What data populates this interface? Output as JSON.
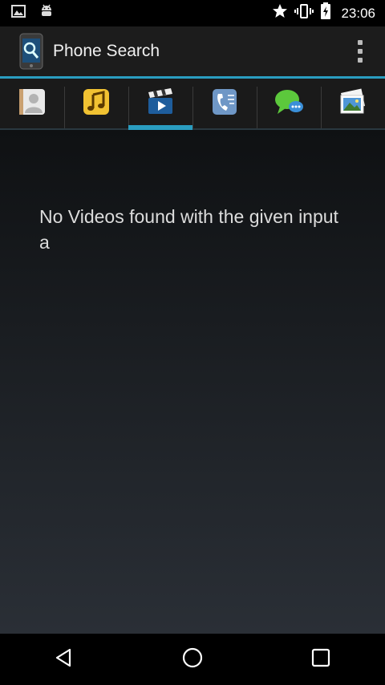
{
  "status_bar": {
    "time": "23:06",
    "icons": [
      "image-notification-icon",
      "android-notification-icon",
      "star-icon",
      "vibrate-icon",
      "battery-icon"
    ]
  },
  "app": {
    "title": "Phone Search",
    "accent_color": "#2a9dc0"
  },
  "tabs": [
    {
      "name": "contacts",
      "icon": "contacts-icon",
      "active": false
    },
    {
      "name": "music",
      "icon": "music-note-icon",
      "active": false
    },
    {
      "name": "videos",
      "icon": "video-clapperboard-icon",
      "active": true
    },
    {
      "name": "call-log",
      "icon": "call-log-icon",
      "active": false
    },
    {
      "name": "messages",
      "icon": "message-bubble-icon",
      "active": false
    },
    {
      "name": "photos",
      "icon": "photos-icon",
      "active": false
    }
  ],
  "main": {
    "empty_message": "No Videos found with the given input a"
  },
  "nav_bar": {
    "buttons": [
      "back-icon",
      "home-icon",
      "recents-icon"
    ]
  }
}
